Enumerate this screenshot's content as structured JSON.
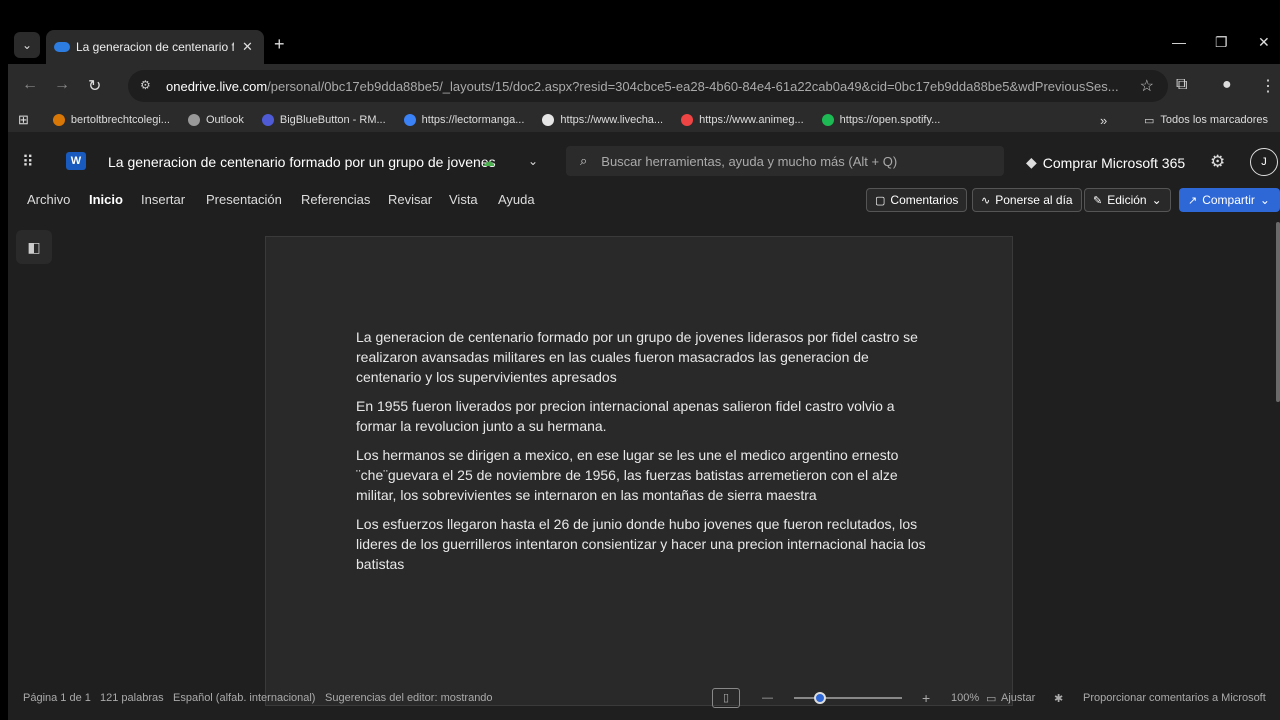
{
  "browser": {
    "tab_title": "La generacion de centenario fo",
    "url_host": "onedrive.live.com",
    "url_path": "/personal/0bc17eb9dda88be5/_layouts/15/doc2.aspx?resid=304cbce5-ea28-4b60-84e4-61a22cab0a49&cid=0bc17eb9dda88be5&wdPreviousSes...",
    "bookmarks": [
      "bertoltbrechtcolegi...",
      "Outlook",
      "BigBlueButton - RM...",
      "https://lectormanga...",
      "https://www.livecha...",
      "https://www.animeg...",
      "https://open.spotify..."
    ],
    "all_bookmarks": "Todos los marcadores"
  },
  "app": {
    "word_letter": "W",
    "doc_title": "La generacion de centenario formado por un grupo de jovenes",
    "search_placeholder": "Buscar herramientas, ayuda y mucho más (Alt + Q)",
    "buy_label": "Comprar Microsoft 365",
    "avatar_initial": "J",
    "ribbon_tabs": [
      "Archivo",
      "Inicio",
      "Insertar",
      "Presentación",
      "Referencias",
      "Revisar",
      "Vista",
      "Ayuda"
    ],
    "comments_label": "Comentarios",
    "catchup_label": "Ponerse al día",
    "edit_label": "Edición",
    "share_label": "Compartir"
  },
  "document": {
    "paragraphs": [
      "La generacion de centenario formado por un grupo de jovenes liderasos por fidel castro se realizaron avansadas militares en las cuales fueron masacrados las generacion de centenario y los supervivientes apresados",
      "En 1955 fueron liverados por precion internacional apenas salieron fidel castro volvio a formar la revolucion junto a su hermana.",
      "Los hermanos se dirigen a mexico, en ese lugar se les une el medico argentino ernesto ¨che¨guevara el 25 de noviembre de 1956, las fuerzas batistas arremetieron con el alze militar, los sobrevivientes se internaron en las montañas de sierra maestra",
      "Los esfuerzos llegaron hasta el 26 de junio donde hubo jovenes que fueron reclutados, los lideres de los guerrilleros intentaron consientizar y hacer una precion internacional hacia los batistas"
    ]
  },
  "status": {
    "page": "Página 1 de 1",
    "words": "121 palabras",
    "language": "Español (alfab. internacional)",
    "editor": "Sugerencias del editor: mostrando",
    "zoom": "100%",
    "fit": "Ajustar",
    "feedback": "Proporcionar comentarios a Microsoft"
  },
  "colors": {
    "accent": "#2e67d6",
    "saved": "#4caf50",
    "page_bg": "#292929"
  }
}
